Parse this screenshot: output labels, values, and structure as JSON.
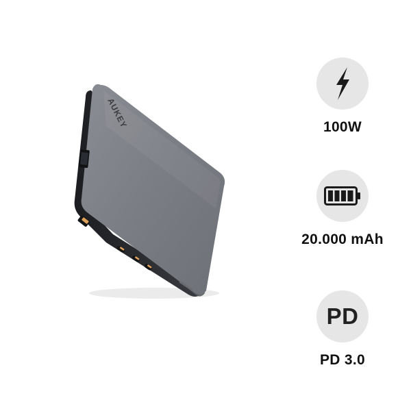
{
  "product": {
    "brand_text": "AUKEY",
    "body_color": "#7d7f86",
    "edge_color": "#2a2b2f",
    "port_accent_color": "#e0a35c"
  },
  "specs": [
    {
      "icon": "lightning-bolt-icon",
      "label": "100W"
    },
    {
      "icon": "battery-full-icon",
      "label": "20.000 mAh"
    },
    {
      "icon_text": "PD",
      "label": "PD 3.0"
    }
  ],
  "colors": {
    "circle_bg": "#e6e6e6",
    "icon": "#1a1a1a",
    "label": "#111111"
  }
}
